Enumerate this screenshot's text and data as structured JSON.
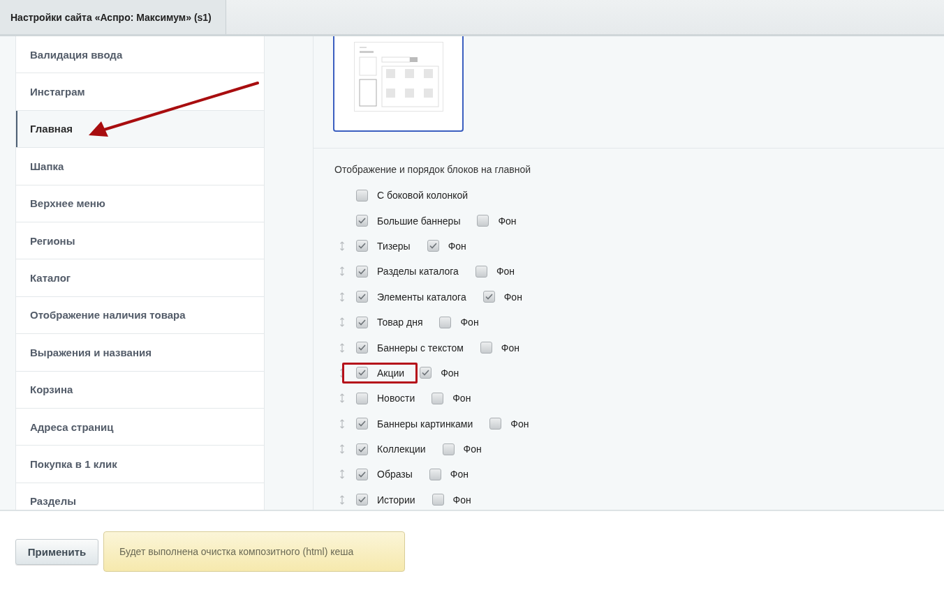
{
  "tabs": [
    {
      "label": "Настройки сайта «Аспро: Максимум» (s1)",
      "selected": true
    }
  ],
  "sidebar": {
    "items": [
      {
        "label": "Валидация ввода",
        "selected": false
      },
      {
        "label": "Инстаграм",
        "selected": false
      },
      {
        "label": "Главная",
        "selected": true
      },
      {
        "label": "Шапка",
        "selected": false
      },
      {
        "label": "Верхнее меню",
        "selected": false
      },
      {
        "label": "Регионы",
        "selected": false
      },
      {
        "label": "Каталог",
        "selected": false
      },
      {
        "label": "Отображение наличия товара",
        "selected": false
      },
      {
        "label": "Выражения и названия",
        "selected": false
      },
      {
        "label": "Корзина",
        "selected": false
      },
      {
        "label": "Адреса страниц",
        "selected": false
      },
      {
        "label": "Покупка в 1 клик",
        "selected": false
      },
      {
        "label": "Разделы",
        "selected": false
      }
    ]
  },
  "blocks": {
    "title": "Отображение и порядок блоков на главной",
    "rows": [
      {
        "label": "С боковой колонкой",
        "checked": false,
        "draggable": false,
        "highlighted": false
      },
      {
        "label": "Большие баннеры",
        "checked": true,
        "draggable": false,
        "highlighted": false,
        "background": {
          "label": "Фон",
          "checked": false
        }
      },
      {
        "label": "Тизеры",
        "checked": true,
        "draggable": true,
        "highlighted": false,
        "background": {
          "label": "Фон",
          "checked": true
        }
      },
      {
        "label": "Разделы каталога",
        "checked": true,
        "draggable": true,
        "highlighted": false,
        "background": {
          "label": "Фон",
          "checked": false
        }
      },
      {
        "label": "Элементы каталога",
        "checked": true,
        "draggable": true,
        "highlighted": false,
        "background": {
          "label": "Фон",
          "checked": true
        }
      },
      {
        "label": "Товар дня",
        "checked": true,
        "draggable": true,
        "highlighted": false,
        "background": {
          "label": "Фон",
          "checked": false
        }
      },
      {
        "label": "Баннеры с текстом",
        "checked": true,
        "draggable": true,
        "highlighted": false,
        "background": {
          "label": "Фон",
          "checked": false
        }
      },
      {
        "label": "Акции",
        "checked": true,
        "draggable": true,
        "highlighted": true,
        "background": {
          "label": "Фон",
          "checked": true
        }
      },
      {
        "label": "Новости",
        "checked": false,
        "draggable": true,
        "highlighted": false,
        "background": {
          "label": "Фон",
          "checked": false
        }
      },
      {
        "label": "Баннеры картинками",
        "checked": true,
        "draggable": true,
        "highlighted": false,
        "background": {
          "label": "Фон",
          "checked": false
        }
      },
      {
        "label": "Коллекции",
        "checked": true,
        "draggable": true,
        "highlighted": false,
        "background": {
          "label": "Фон",
          "checked": false
        }
      },
      {
        "label": "Образы",
        "checked": true,
        "draggable": true,
        "highlighted": false,
        "background": {
          "label": "Фон",
          "checked": false
        }
      },
      {
        "label": "Истории",
        "checked": true,
        "draggable": true,
        "highlighted": false,
        "background": {
          "label": "Фон",
          "checked": false
        }
      }
    ]
  },
  "footer": {
    "apply_button": "Применить",
    "notice": "Будет выполнена очистка композитного (html) кеша"
  }
}
